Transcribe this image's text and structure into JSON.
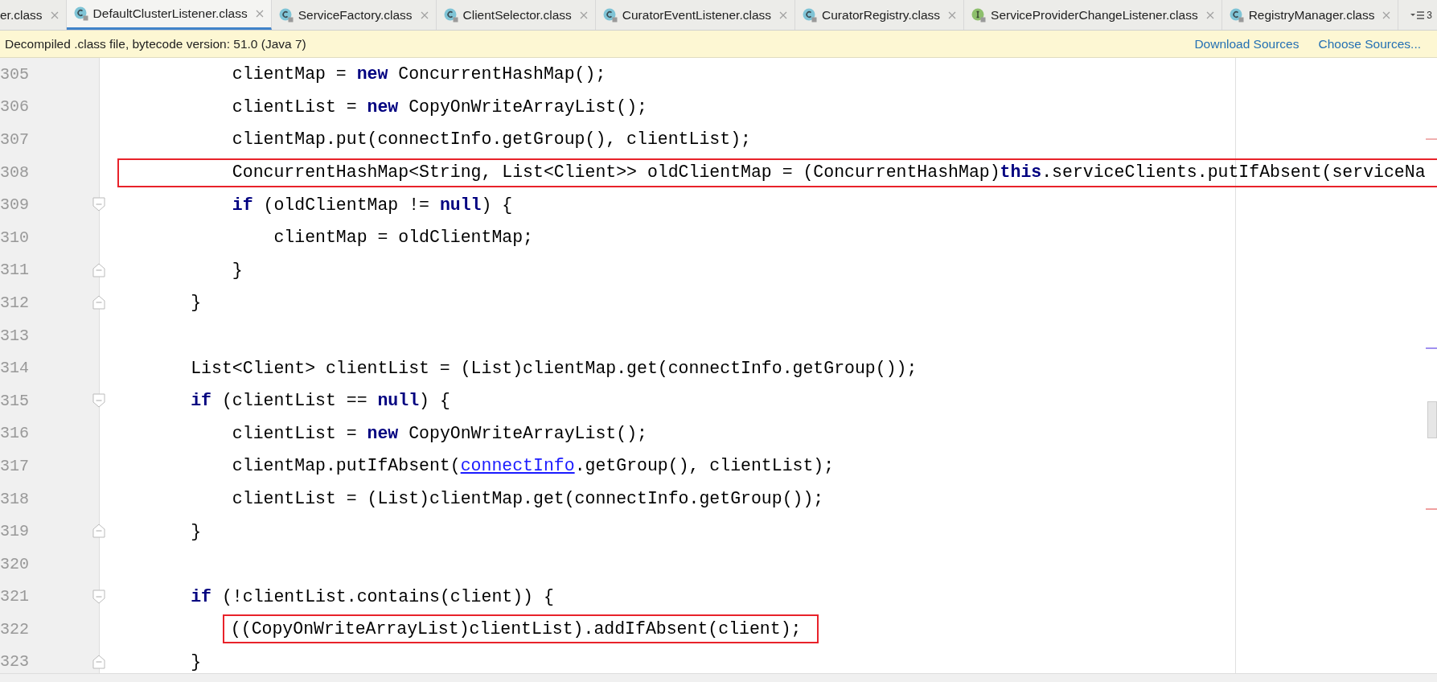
{
  "tabs": [
    {
      "label": "er.class",
      "selected": false,
      "kind": "plain",
      "closable": true
    },
    {
      "label": "DefaultClusterListener.class",
      "selected": true,
      "kind": "class",
      "closable": true
    },
    {
      "label": "ServiceFactory.class",
      "selected": false,
      "kind": "class",
      "closable": true
    },
    {
      "label": "ClientSelector.class",
      "selected": false,
      "kind": "class",
      "closable": true
    },
    {
      "label": "CuratorEventListener.class",
      "selected": false,
      "kind": "class",
      "closable": true
    },
    {
      "label": "CuratorRegistry.class",
      "selected": false,
      "kind": "class",
      "closable": true
    },
    {
      "label": "ServiceProviderChangeListener.class",
      "selected": false,
      "kind": "interface",
      "closable": true
    },
    {
      "label": "RegistryManager.class",
      "selected": false,
      "kind": "class",
      "closable": true
    }
  ],
  "tab_overflow": {
    "count": "3"
  },
  "notification": {
    "message": "Decompiled .class file, bytecode version: 51.0 (Java 7)",
    "actions": [
      "Download Sources",
      "Choose Sources..."
    ]
  },
  "lines": [
    {
      "number": "305",
      "kind": "plain",
      "fold_start": false,
      "fold_end": false,
      "segments": [
        {
          "kind": "plain",
          "text": "            clientMap = "
        },
        {
          "kind": "keyword",
          "text": "new"
        },
        {
          "kind": "plain",
          "text": " ConcurrentHashMap();"
        }
      ]
    },
    {
      "number": "306",
      "kind": "plain",
      "fold_start": false,
      "fold_end": false,
      "segments": [
        {
          "kind": "plain",
          "text": "            clientList = "
        },
        {
          "kind": "keyword",
          "text": "new"
        },
        {
          "kind": "plain",
          "text": " CopyOnWriteArrayList();"
        }
      ]
    },
    {
      "number": "307",
      "kind": "plain",
      "fold_start": false,
      "fold_end": false,
      "segments": [
        {
          "kind": "plain",
          "text": "            clientMap.put(connectInfo.getGroup(), clientList);"
        }
      ]
    },
    {
      "number": "308",
      "kind": "spanning",
      "fold_start": false,
      "fold_end": false,
      "segments": [
        {
          "kind": "plain",
          "text": "            ConcurrentHashMap<String, List<Client>> oldClientMap = (ConcurrentHashMap)"
        },
        {
          "kind": "keyword",
          "text": "this"
        },
        {
          "kind": "plain",
          "text": ".serviceClients.putIfAbsent(serviceNa"
        }
      ]
    },
    {
      "number": "309",
      "kind": "plain",
      "fold_start": true,
      "fold_end": false,
      "segments": [
        {
          "kind": "keyword",
          "text": "            if"
        },
        {
          "kind": "plain",
          "text": " (oldClientMap != "
        },
        {
          "kind": "keyword",
          "text": "null"
        },
        {
          "kind": "plain",
          "text": ") {"
        }
      ]
    },
    {
      "number": "310",
      "kind": "plain",
      "fold_start": false,
      "fold_end": false,
      "segments": [
        {
          "kind": "plain",
          "text": "                clientMap = oldClientMap;"
        }
      ]
    },
    {
      "number": "311",
      "kind": "plain",
      "fold_start": false,
      "fold_end": true,
      "segments": [
        {
          "kind": "plain",
          "text": "            }"
        }
      ]
    },
    {
      "number": "312",
      "kind": "plain",
      "fold_start": false,
      "fold_end": true,
      "segments": [
        {
          "kind": "plain",
          "text": "        }"
        }
      ]
    },
    {
      "number": "313",
      "kind": "plain",
      "fold_start": false,
      "fold_end": false
    },
    {
      "number": "314",
      "kind": "plain",
      "fold_start": false,
      "fold_end": false,
      "segments": [
        {
          "kind": "plain",
          "text": "        List<Client> clientList = (List)clientMap.get(connectInfo.getGroup());"
        }
      ]
    },
    {
      "number": "315",
      "kind": "plain",
      "fold_start": true,
      "fold_end": false,
      "segments": [
        {
          "kind": "keyword",
          "text": "        if"
        },
        {
          "kind": "plain",
          "text": " (clientList == "
        },
        {
          "kind": "keyword",
          "text": "null"
        },
        {
          "kind": "plain",
          "text": ") {"
        }
      ]
    },
    {
      "number": "316",
      "kind": "plain",
      "fold_start": false,
      "fold_end": false,
      "segments": [
        {
          "kind": "plain",
          "text": "            clientList = "
        },
        {
          "kind": "keyword",
          "text": "new"
        },
        {
          "kind": "plain",
          "text": " CopyOnWriteArrayList();"
        }
      ]
    },
    {
      "number": "317",
      "kind": "plain",
      "fold_start": false,
      "fold_end": false,
      "segments": [
        {
          "kind": "plain",
          "text": "            clientMap.putIfAbsent("
        },
        {
          "kind": "link",
          "text": "connectInfo"
        },
        {
          "kind": "plain",
          "text": ".getGroup(), clientList);"
        }
      ]
    },
    {
      "number": "318",
      "kind": "plain",
      "fold_start": false,
      "fold_end": false,
      "segments": [
        {
          "kind": "plain",
          "text": "            clientList = (List)clientMap.get(connectInfo.getGroup());"
        }
      ]
    },
    {
      "number": "319",
      "kind": "plain",
      "fold_start": false,
      "fold_end": true,
      "segments": [
        {
          "kind": "plain",
          "text": "        }"
        }
      ]
    },
    {
      "number": "320",
      "kind": "plain",
      "fold_start": false,
      "fold_end": false
    },
    {
      "number": "321",
      "kind": "plain",
      "fold_start": true,
      "fold_end": false,
      "segments": [
        {
          "kind": "keyword",
          "text": "        if"
        },
        {
          "kind": "plain",
          "text": " (!clientList.contains(client)) {"
        }
      ]
    },
    {
      "number": "322",
      "kind": "framed",
      "fold_start": false,
      "fold_end": false,
      "segments": [
        {
          "kind": "plain",
          "text": "            ((CopyOnWriteArrayList)clientList).addIfAbsent(client);"
        }
      ]
    },
    {
      "number": "323",
      "kind": "plain",
      "fold_start": false,
      "fold_end": true,
      "segments": [
        {
          "kind": "plain",
          "text": "        }"
        }
      ]
    }
  ]
}
